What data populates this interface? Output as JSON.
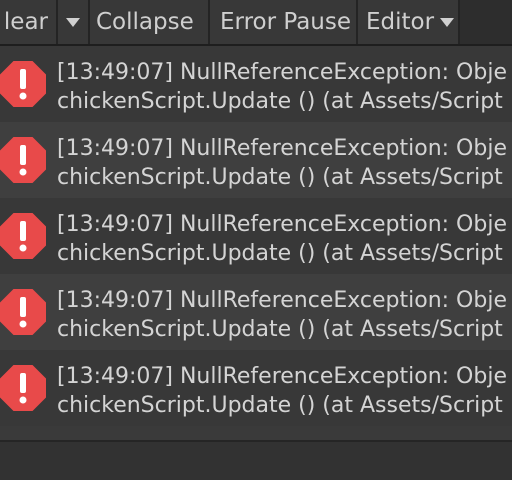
{
  "toolbar": {
    "clear_label": "lear",
    "collapse_label": "Collapse",
    "error_pause_label": "Error Pause",
    "editor_label": "Editor",
    "clear_dropdown_icon": "chevron-down-icon",
    "editor_dropdown_icon": "chevron-down-icon"
  },
  "logs": [
    {
      "line1": "[13:49:07] NullReferenceException: Obje",
      "line2": "chickenScript.Update () (at Assets/Script",
      "icon": "error-icon"
    },
    {
      "line1": "[13:49:07] NullReferenceException: Obje",
      "line2": "chickenScript.Update () (at Assets/Script",
      "icon": "error-icon"
    },
    {
      "line1": "[13:49:07] NullReferenceException: Obje",
      "line2": "chickenScript.Update () (at Assets/Script",
      "icon": "error-icon"
    },
    {
      "line1": "[13:49:07] NullReferenceException: Obje",
      "line2": "chickenScript.Update () (at Assets/Script",
      "icon": "error-icon"
    },
    {
      "line1": "[13:49:07] NullReferenceException: Obje",
      "line2": "chickenScript.Update () (at Assets/Script",
      "icon": "error-icon"
    }
  ],
  "colors": {
    "error_icon": "#e84a4a",
    "background": "#3a3a3a",
    "toolbar": "#2d2d2d"
  }
}
